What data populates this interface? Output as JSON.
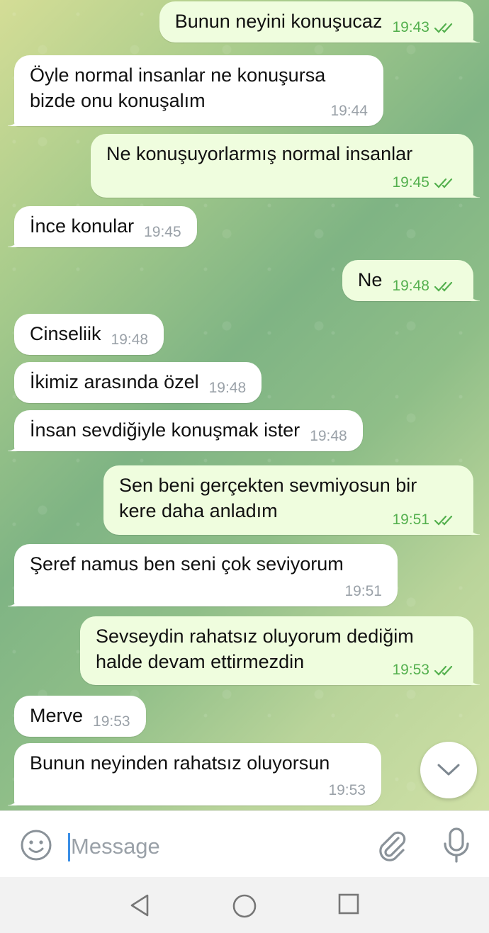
{
  "messages": [
    {
      "text": "Bunun neyini konuşucaz",
      "time": "19:43",
      "direction": "outgoing",
      "status": "read"
    },
    {
      "text": "Öyle normal insanlar ne konuşursa\nbizde onu konuşalım",
      "time": "19:44",
      "direction": "incoming"
    },
    {
      "text": "Ne konuşuyorlarmış normal insanlar",
      "time": "19:45",
      "direction": "outgoing",
      "status": "read"
    },
    {
      "text": "İnce konular",
      "time": "19:45",
      "direction": "incoming"
    },
    {
      "text": "Ne",
      "time": "19:48",
      "direction": "outgoing",
      "status": "read"
    },
    {
      "text": "Cinseliik",
      "time": "19:48",
      "direction": "incoming"
    },
    {
      "text": "İkimiz arasında özel",
      "time": "19:48",
      "direction": "incoming"
    },
    {
      "text": "İnsan sevdiğiyle konuşmak ister",
      "time": "19:48",
      "direction": "incoming"
    },
    {
      "text": "Sen beni gerçekten sevmiyosun bir\nkere daha anladım",
      "time": "19:51",
      "direction": "outgoing",
      "status": "read"
    },
    {
      "text": "Şeref namus ben seni çok seviyorum",
      "time": "19:51",
      "direction": "incoming"
    },
    {
      "text": "Sevseydin rahatsız oluyorum dediğim\nhalde devam ettirmezdin",
      "time": "19:53",
      "direction": "outgoing",
      "status": "read"
    },
    {
      "text": "Merve",
      "time": "19:53",
      "direction": "incoming"
    },
    {
      "text": "Bunun neyinden rahatsız oluyorsun",
      "time": "19:53",
      "direction": "incoming"
    }
  ],
  "composer": {
    "placeholder": "Message",
    "value": ""
  },
  "icons": {
    "emoji": "smiley-face-icon",
    "attach": "paperclip-icon",
    "mic": "microphone-icon",
    "scroll_down": "chevron-down-icon",
    "nav_back": "triangle-back-icon",
    "nav_home": "circle-home-icon",
    "nav_recent": "square-recent-icon"
  },
  "colors": {
    "incoming_bubble": "#ffffff",
    "outgoing_bubble": "#effdde",
    "read_ticks": "#54b04e",
    "timestamp_gray": "#9aa1a8",
    "input_cursor": "#3a8ee6"
  }
}
